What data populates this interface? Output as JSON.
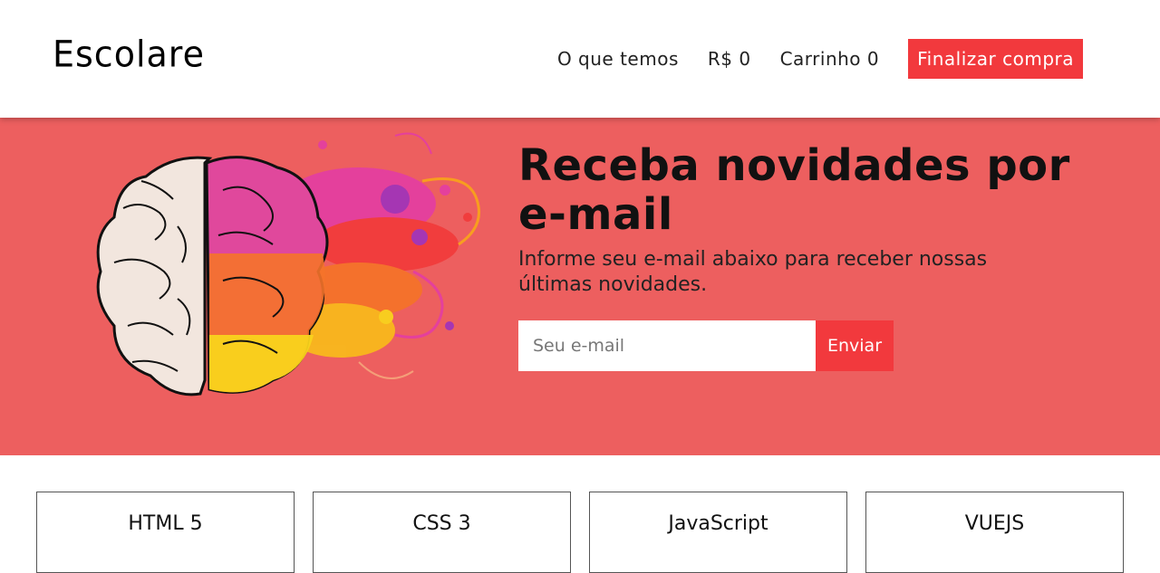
{
  "header": {
    "logo": "Escolare",
    "nav": {
      "about": "O que temos",
      "price": "R$ 0",
      "cart": "Carrinho 0",
      "checkout": "Finalizar compra"
    }
  },
  "hero": {
    "title": "Receba novidades por e-mail",
    "subtitle": "Informe seu e-mail abaixo para receber nossas últimas novidades.",
    "email_placeholder": "Seu e-mail",
    "send_label": "Enviar",
    "image": "brain-illustration"
  },
  "courses": [
    {
      "title": "HTML 5"
    },
    {
      "title": "CSS 3"
    },
    {
      "title": "JavaScript"
    },
    {
      "title": "VUEJS"
    }
  ],
  "colors": {
    "accent": "#f2393d",
    "hero_bg": "#ed5f5f"
  }
}
